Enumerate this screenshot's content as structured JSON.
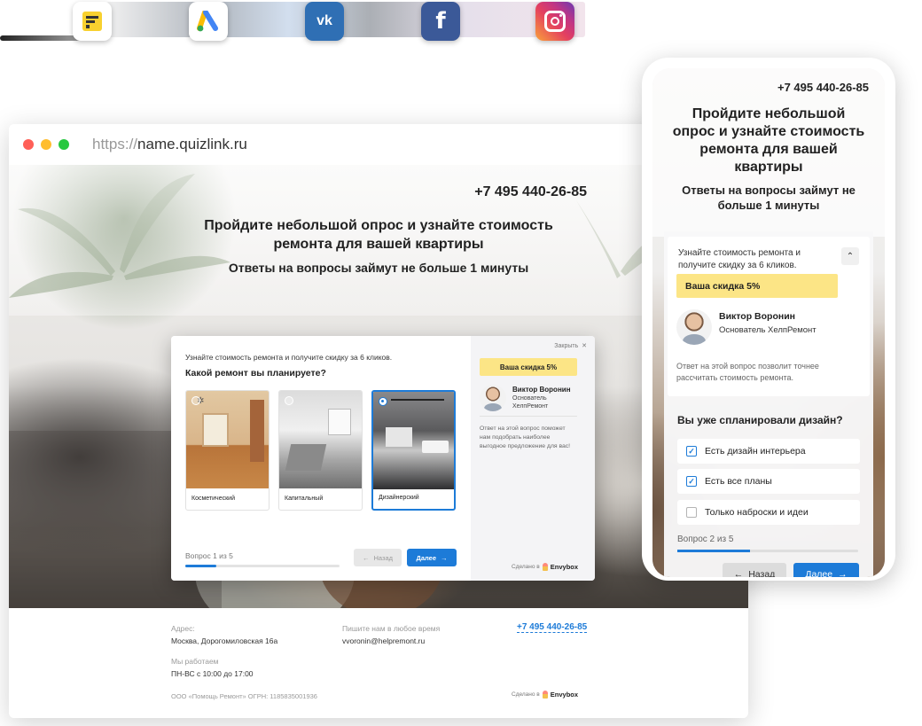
{
  "integrations": [
    {
      "name": "yandex-forms-icon",
      "color": "#f8d12f"
    },
    {
      "name": "google-ads-icon",
      "color": "#4285f4"
    },
    {
      "name": "vk-icon",
      "color": "#2f6fb4",
      "glyph": "vk"
    },
    {
      "name": "facebook-icon",
      "color": "#3b5998",
      "glyph": "f"
    },
    {
      "name": "instagram-icon",
      "color": "#d62976"
    }
  ],
  "browser": {
    "url_protocol": "https://",
    "url_host": "name.quizlink.ru"
  },
  "desktop": {
    "phone": "+7 495 440-26-85",
    "title_line1": "Пройдите небольшой опрос и узнайте стоимость",
    "title_line2": "ремонта для вашей квартиры",
    "subtitle": "Ответы на вопросы займут не больше 1 минуты",
    "quiz": {
      "hint": "Узнайте стоимость ремонта и получите скидку за 6 кликов.",
      "question": "Какой ремонт вы планируете?",
      "options": [
        {
          "label": "Косметический",
          "selected": false
        },
        {
          "label": "Капитальный",
          "selected": false
        },
        {
          "label": "Дизайнерский",
          "selected": true
        }
      ],
      "progress_text": "Вопрос 1 из 5",
      "progress": 0.2,
      "back_label": "Назад",
      "next_label": "Далее",
      "close_label": "Закрыть",
      "discount": "Ваша скидка 5%",
      "manager_name": "Виктор Воронин",
      "manager_role": "Основатель ХелпРемонт",
      "note": "Ответ на этой вопрос поможет нам подобрать наиболее выгодное предложение для вас!",
      "made_by": "Сделано в",
      "brand": "Envybox"
    },
    "footer": {
      "address_label": "Адрес:",
      "address": "Москва, Дорогомиловская 16а",
      "hours_label": "Мы работаем",
      "hours": "ПН-ВС с 10:00 до 17:00",
      "write_label": "Пишите нам в любое время",
      "email": "vvoronin@helpremont.ru",
      "phone": "+7 495 440-26-85",
      "legal": "ООО «Помощь Ремонт» ОГРН: 1185835001936",
      "made_by": "Сделано в",
      "brand": "Envybox"
    }
  },
  "mobile": {
    "phone": "+7 495 440-26-85",
    "title_line1": "Пройдите небольшой",
    "title_line2": "опрос и узнайте стоимость",
    "title_line3": "ремонта для вашей",
    "title_line4": "квартиры",
    "subtitle_line1": "Ответы на вопросы займут не",
    "subtitle_line2": "больше 1 минуты",
    "hint": "Узнайте стоимость ремонта и получите скидку за 6 кликов.",
    "discount": "Ваша скидка 5%",
    "manager_name": "Виктор Воронин",
    "manager_role": "Основатель  ХелпРемонт",
    "note": "Ответ на этой вопрос позволит точнее рассчитать стоимость ремонта.",
    "question": "Вы уже спланировали дизайн?",
    "options": [
      {
        "label": "Есть дизайн интерьера",
        "checked": true
      },
      {
        "label": "Есть все планы",
        "checked": true
      },
      {
        "label": "Только наброски и идеи",
        "checked": false
      }
    ],
    "progress_text": "Вопрос 2 из 5",
    "progress": 0.4,
    "back_label": "Назад",
    "next_label": "Далее"
  }
}
